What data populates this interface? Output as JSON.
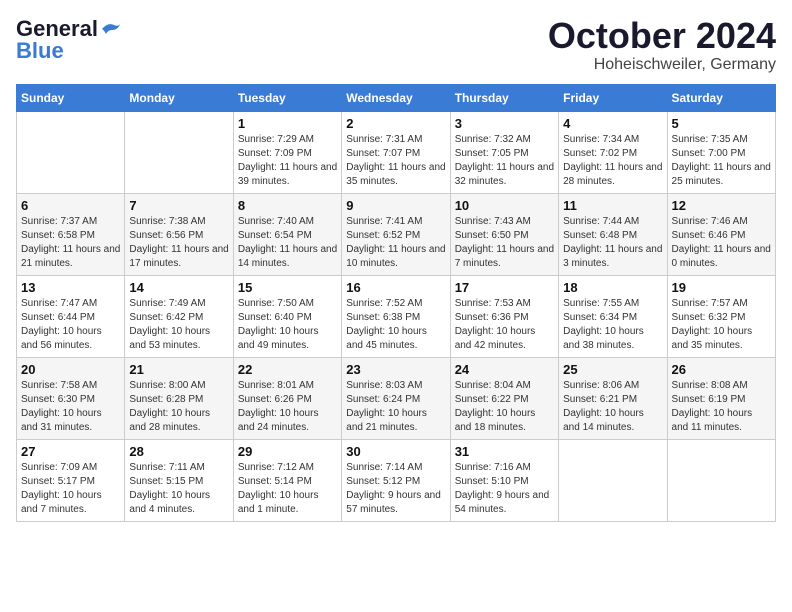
{
  "logo": {
    "line1a": "General",
    "line1b": "Blue",
    "line2": "Blue"
  },
  "header": {
    "month": "October 2024",
    "location": "Hoheischweiler, Germany"
  },
  "weekdays": [
    "Sunday",
    "Monday",
    "Tuesday",
    "Wednesday",
    "Thursday",
    "Friday",
    "Saturday"
  ],
  "weeks": [
    [
      {
        "day": "",
        "detail": ""
      },
      {
        "day": "",
        "detail": ""
      },
      {
        "day": "1",
        "detail": "Sunrise: 7:29 AM\nSunset: 7:09 PM\nDaylight: 11 hours and 39 minutes."
      },
      {
        "day": "2",
        "detail": "Sunrise: 7:31 AM\nSunset: 7:07 PM\nDaylight: 11 hours and 35 minutes."
      },
      {
        "day": "3",
        "detail": "Sunrise: 7:32 AM\nSunset: 7:05 PM\nDaylight: 11 hours and 32 minutes."
      },
      {
        "day": "4",
        "detail": "Sunrise: 7:34 AM\nSunset: 7:02 PM\nDaylight: 11 hours and 28 minutes."
      },
      {
        "day": "5",
        "detail": "Sunrise: 7:35 AM\nSunset: 7:00 PM\nDaylight: 11 hours and 25 minutes."
      }
    ],
    [
      {
        "day": "6",
        "detail": "Sunrise: 7:37 AM\nSunset: 6:58 PM\nDaylight: 11 hours and 21 minutes."
      },
      {
        "day": "7",
        "detail": "Sunrise: 7:38 AM\nSunset: 6:56 PM\nDaylight: 11 hours and 17 minutes."
      },
      {
        "day": "8",
        "detail": "Sunrise: 7:40 AM\nSunset: 6:54 PM\nDaylight: 11 hours and 14 minutes."
      },
      {
        "day": "9",
        "detail": "Sunrise: 7:41 AM\nSunset: 6:52 PM\nDaylight: 11 hours and 10 minutes."
      },
      {
        "day": "10",
        "detail": "Sunrise: 7:43 AM\nSunset: 6:50 PM\nDaylight: 11 hours and 7 minutes."
      },
      {
        "day": "11",
        "detail": "Sunrise: 7:44 AM\nSunset: 6:48 PM\nDaylight: 11 hours and 3 minutes."
      },
      {
        "day": "12",
        "detail": "Sunrise: 7:46 AM\nSunset: 6:46 PM\nDaylight: 11 hours and 0 minutes."
      }
    ],
    [
      {
        "day": "13",
        "detail": "Sunrise: 7:47 AM\nSunset: 6:44 PM\nDaylight: 10 hours and 56 minutes."
      },
      {
        "day": "14",
        "detail": "Sunrise: 7:49 AM\nSunset: 6:42 PM\nDaylight: 10 hours and 53 minutes."
      },
      {
        "day": "15",
        "detail": "Sunrise: 7:50 AM\nSunset: 6:40 PM\nDaylight: 10 hours and 49 minutes."
      },
      {
        "day": "16",
        "detail": "Sunrise: 7:52 AM\nSunset: 6:38 PM\nDaylight: 10 hours and 45 minutes."
      },
      {
        "day": "17",
        "detail": "Sunrise: 7:53 AM\nSunset: 6:36 PM\nDaylight: 10 hours and 42 minutes."
      },
      {
        "day": "18",
        "detail": "Sunrise: 7:55 AM\nSunset: 6:34 PM\nDaylight: 10 hours and 38 minutes."
      },
      {
        "day": "19",
        "detail": "Sunrise: 7:57 AM\nSunset: 6:32 PM\nDaylight: 10 hours and 35 minutes."
      }
    ],
    [
      {
        "day": "20",
        "detail": "Sunrise: 7:58 AM\nSunset: 6:30 PM\nDaylight: 10 hours and 31 minutes."
      },
      {
        "day": "21",
        "detail": "Sunrise: 8:00 AM\nSunset: 6:28 PM\nDaylight: 10 hours and 28 minutes."
      },
      {
        "day": "22",
        "detail": "Sunrise: 8:01 AM\nSunset: 6:26 PM\nDaylight: 10 hours and 24 minutes."
      },
      {
        "day": "23",
        "detail": "Sunrise: 8:03 AM\nSunset: 6:24 PM\nDaylight: 10 hours and 21 minutes."
      },
      {
        "day": "24",
        "detail": "Sunrise: 8:04 AM\nSunset: 6:22 PM\nDaylight: 10 hours and 18 minutes."
      },
      {
        "day": "25",
        "detail": "Sunrise: 8:06 AM\nSunset: 6:21 PM\nDaylight: 10 hours and 14 minutes."
      },
      {
        "day": "26",
        "detail": "Sunrise: 8:08 AM\nSunset: 6:19 PM\nDaylight: 10 hours and 11 minutes."
      }
    ],
    [
      {
        "day": "27",
        "detail": "Sunrise: 7:09 AM\nSunset: 5:17 PM\nDaylight: 10 hours and 7 minutes."
      },
      {
        "day": "28",
        "detail": "Sunrise: 7:11 AM\nSunset: 5:15 PM\nDaylight: 10 hours and 4 minutes."
      },
      {
        "day": "29",
        "detail": "Sunrise: 7:12 AM\nSunset: 5:14 PM\nDaylight: 10 hours and 1 minute."
      },
      {
        "day": "30",
        "detail": "Sunrise: 7:14 AM\nSunset: 5:12 PM\nDaylight: 9 hours and 57 minutes."
      },
      {
        "day": "31",
        "detail": "Sunrise: 7:16 AM\nSunset: 5:10 PM\nDaylight: 9 hours and 54 minutes."
      },
      {
        "day": "",
        "detail": ""
      },
      {
        "day": "",
        "detail": ""
      }
    ]
  ]
}
